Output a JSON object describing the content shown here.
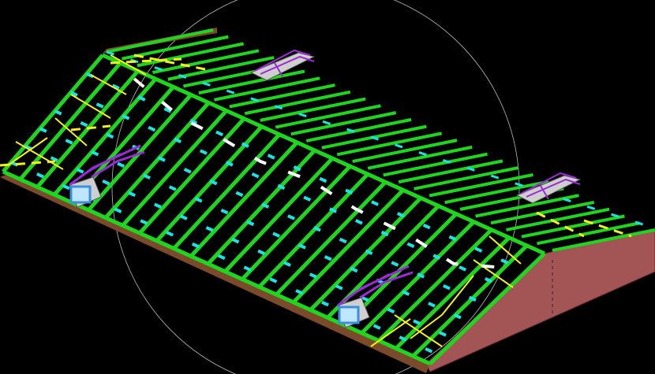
{
  "scene": {
    "background_color": "#000000",
    "colors": {
      "rafter_green": "#1fd61f",
      "purlin_cyan": "#19e3e3",
      "ridge_white": "#ffffff",
      "bracing_yellow": "#f2f21a",
      "dormer_purple": "#9c2bd6",
      "window_blue": "#3a8fe0",
      "window_glass": "#bfe6ff",
      "roof_edge_brown": "#7a4a2a",
      "gable_wall": "#a35454",
      "ucs_circle": "#bbbbbb"
    },
    "objects": {
      "rafter_count": 26,
      "dormer_count": 4,
      "dormer_style": "lucarne"
    }
  }
}
